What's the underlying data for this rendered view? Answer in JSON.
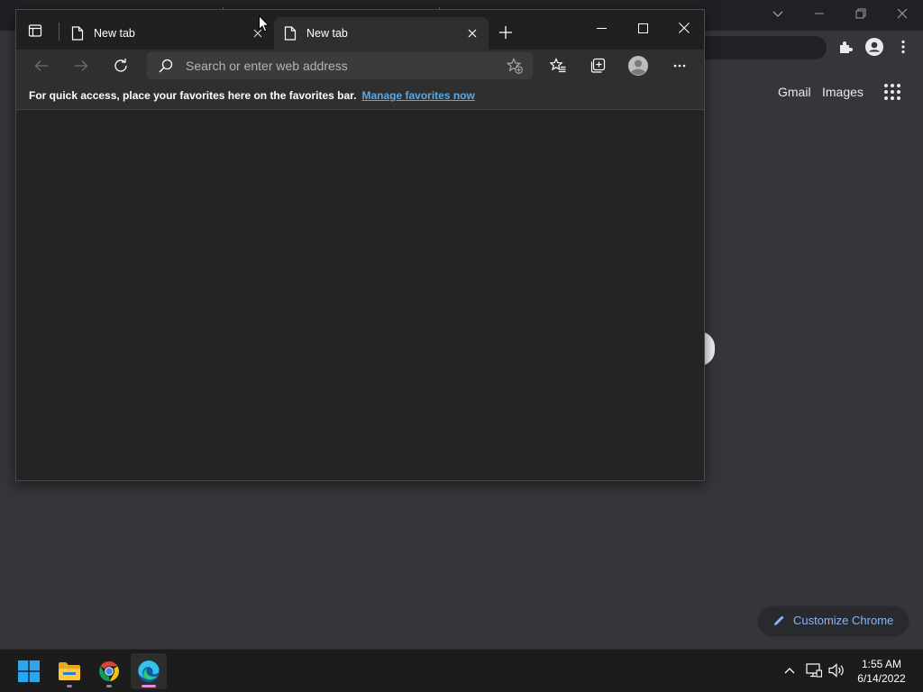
{
  "chrome_background": {
    "header_links": {
      "gmail": "Gmail",
      "images": "Images"
    },
    "apps_icon": "apps-grid-icon",
    "customize_button": {
      "label": "Customize Chrome",
      "icon": "pencil-icon"
    },
    "toolbar_icons": [
      "share-icon",
      "star-icon",
      "extensions-icon",
      "profile-icon",
      "more-vert-icon"
    ],
    "caption_icons": [
      "chevron-down-icon",
      "minimize-icon",
      "restore-icon",
      "close-icon"
    ]
  },
  "edge": {
    "tabs": [
      {
        "title": "New tab",
        "active": false
      },
      {
        "title": "New tab",
        "active": true
      }
    ],
    "address_bar": {
      "placeholder": "Search or enter web address",
      "value": ""
    },
    "favorites_bar": {
      "message": "For quick access, place your favorites here on the favorites bar.",
      "link": "Manage favorites now"
    },
    "toolbar_icons": [
      "back-icon",
      "forward-icon",
      "refresh-icon",
      "favorites-icon",
      "collections-icon",
      "profile-icon",
      "more-icon"
    ],
    "caption_icons": [
      "minimize-icon",
      "maximize-icon",
      "close-icon"
    ]
  },
  "taskbar": {
    "apps": [
      "windows-start-icon",
      "file-explorer-icon",
      "chrome-icon",
      "edge-icon"
    ],
    "tray_icons": [
      "chevron-up-icon",
      "network-icon",
      "volume-icon"
    ],
    "clock": {
      "time": "1:55 AM",
      "date": "6/14/2022"
    }
  },
  "colors": {
    "edge_accent_link": "#5aa9e6",
    "chrome_accent": "#8ab4f8",
    "edge_active_indicator": "#e58ad8"
  }
}
